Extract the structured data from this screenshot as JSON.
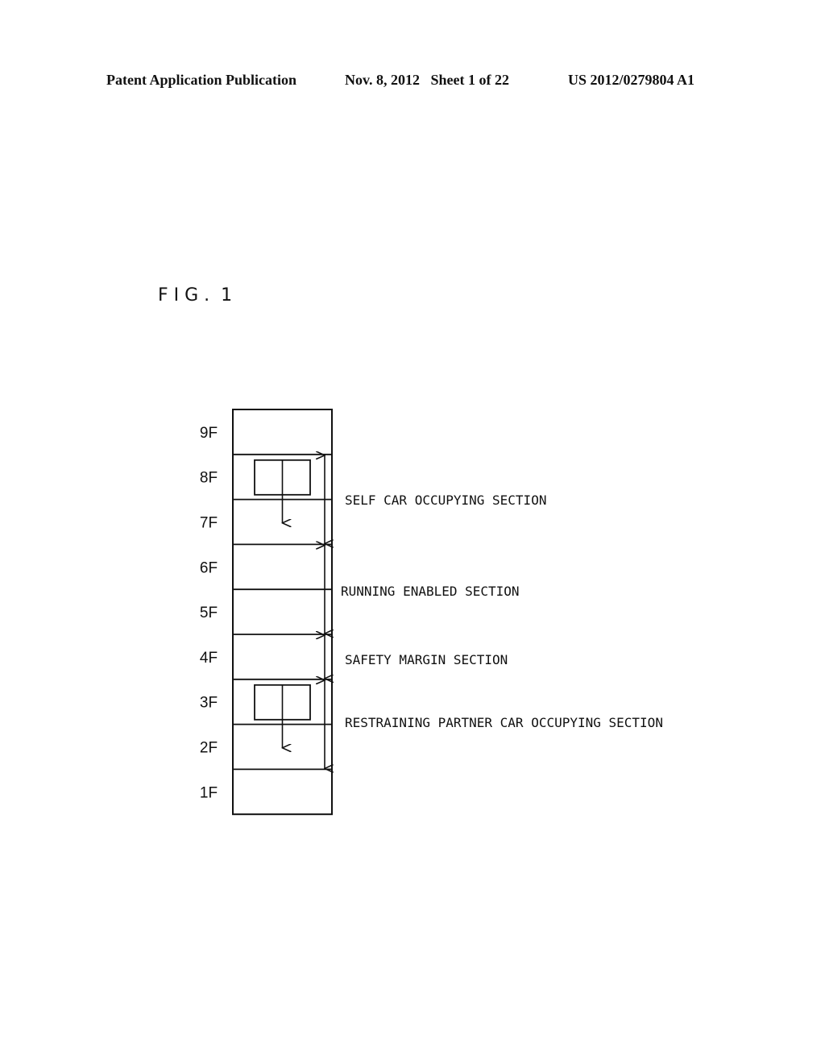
{
  "header": {
    "left": "Patent Application Publication",
    "date_sheet": "Nov. 8, 2012   Sheet 1 of 22",
    "number": "US 2012/0279804 A1"
  },
  "figure": {
    "title": "F I G .  1",
    "floors": [
      "9F",
      "8F",
      "7F",
      "6F",
      "5F",
      "4F",
      "3F",
      "2F",
      "1F"
    ],
    "cars": [
      {
        "name": "self-car",
        "floor": "8F",
        "direction": "down"
      },
      {
        "name": "partner-car",
        "floor": "3F",
        "direction": "down"
      }
    ],
    "sections": [
      {
        "label": "SELF CAR OCCUPYING SECTION",
        "from_floor": "8F",
        "to_floor": "7F"
      },
      {
        "label": "RUNNING ENABLED SECTION",
        "from_floor": "6F",
        "to_floor": "5F"
      },
      {
        "label": "SAFETY MARGIN SECTION",
        "from_floor": "4F",
        "to_floor": "4F"
      },
      {
        "label": "RESTRAINING PARTNER CAR OCCUPYING SECTION",
        "from_floor": "3F",
        "to_floor": "2F"
      }
    ]
  }
}
